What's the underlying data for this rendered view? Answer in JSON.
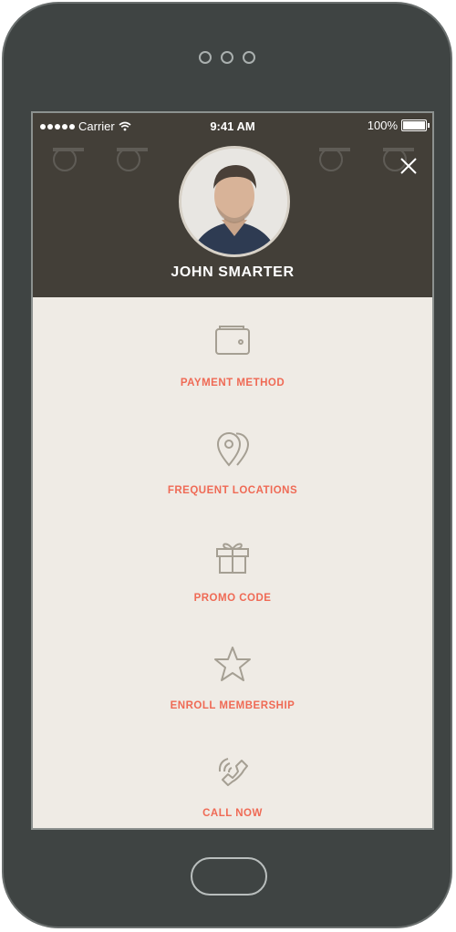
{
  "status_bar": {
    "carrier": "Carrier",
    "time": "9:41 AM",
    "battery": "100%"
  },
  "profile": {
    "name": "JOHN SMARTER"
  },
  "menu": {
    "items": [
      {
        "label": "PAYMENT METHOD",
        "icon": "wallet-icon"
      },
      {
        "label": "FREQUENT LOCATIONS",
        "icon": "location-pins-icon"
      },
      {
        "label": "PROMO CODE",
        "icon": "gift-icon"
      },
      {
        "label": "ENROLL MEMBERSHIP",
        "icon": "star-icon"
      },
      {
        "label": "CALL NOW",
        "icon": "phone-icon"
      }
    ]
  },
  "colors": {
    "accent": "#ef6a55",
    "header_bg": "#433f38",
    "menu_bg": "#efebe5",
    "icon": "#a59f93",
    "device": "#3f4443"
  }
}
